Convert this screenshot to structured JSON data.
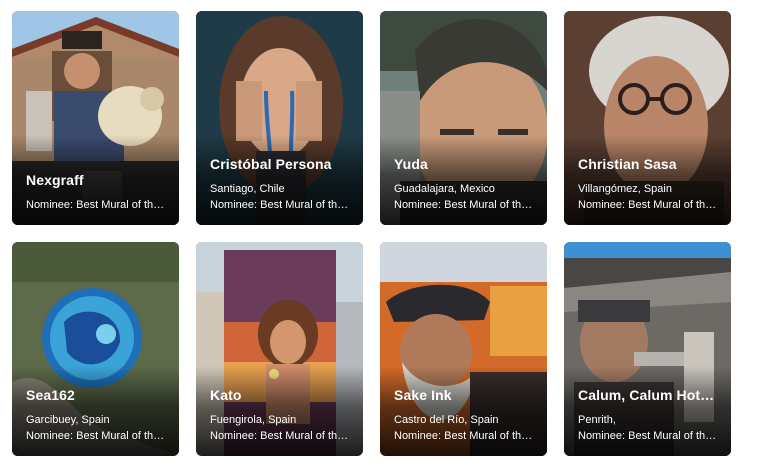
{
  "cards": [
    {
      "name": "Nexgraff",
      "location": "",
      "award": "Nominee: Best Mural of the Year",
      "art": "mural-portrait-with-sheep"
    },
    {
      "name": "Cristóbal Persona",
      "location": "Santiago, Chile",
      "award": "Nominee: Best Mural of the Year",
      "art": "mural-crying-woman"
    },
    {
      "name": "Yuda",
      "location": "Guadalajara, Mexico",
      "award": "Nominee: Best Mural of the Year",
      "art": "mural-child-face"
    },
    {
      "name": "Christian Sasa",
      "location": "Villangómez, Spain",
      "award": "Nominee: Best Mural of the Year",
      "art": "mural-elderly-woman"
    },
    {
      "name": "Sea162",
      "location": "Garcibuey, Spain",
      "award": "Nominee: Best Mural of the Year",
      "art": "mural-aerial-circle"
    },
    {
      "name": "Kato",
      "location": "Fuengirola, Spain",
      "award": "Nominee: Best Mural of the Year",
      "art": "mural-girl-sunset"
    },
    {
      "name": "Sake Ink",
      "location": "Castro del Río, Spain",
      "award": "Nominee: Best Mural of the Year",
      "art": "mural-bearded-man-hat"
    },
    {
      "name": "Calum, Calum Hotham",
      "location": "Penrith,",
      "award": "Nominee: Best Mural of the Year",
      "art": "mural-worker-portrait"
    }
  ]
}
